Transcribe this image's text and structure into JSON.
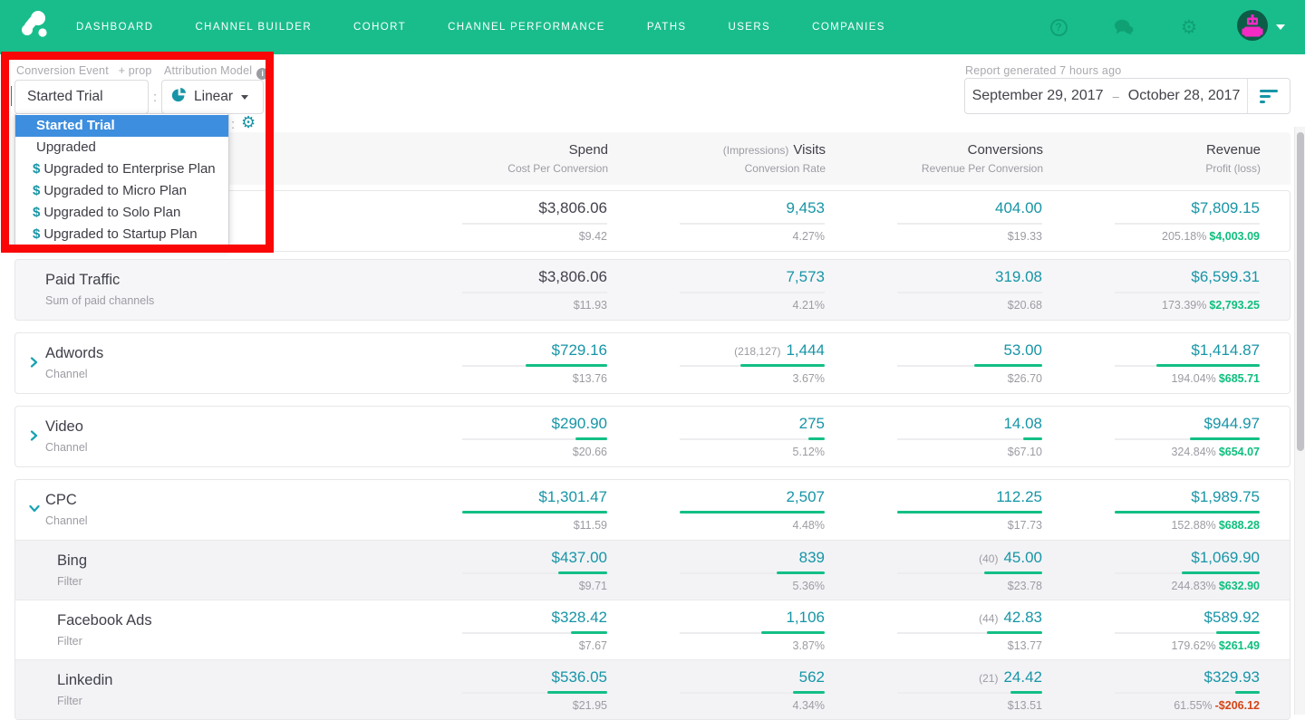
{
  "palette": {
    "nav_green": "#19bd8c",
    "teal_value": "#1795a6",
    "bar_green": "#13bf86",
    "profit_green": "#0ebf7e",
    "loss_red": "#d44517",
    "highlight_blue": "#3d8ede",
    "annotation_red": "#fa0606"
  },
  "nav": {
    "items": [
      {
        "label": "DASHBOARD"
      },
      {
        "label": "CHANNEL BUILDER"
      },
      {
        "label": "COHORT"
      },
      {
        "label": "CHANNEL PERFORMANCE"
      },
      {
        "label": "PATHS"
      },
      {
        "label": "USERS"
      },
      {
        "label": "COMPANIES"
      }
    ],
    "help_glyph": "?",
    "gear_glyph": "⚙"
  },
  "controls": {
    "conversion_event": {
      "label": "Conversion Event",
      "prop_link": "+ prop",
      "value": "Started Trial"
    },
    "separator": ":",
    "attribution_model": {
      "label": "Attribution Model",
      "value": "Linear"
    },
    "dropdown": {
      "items": [
        {
          "prefix": "",
          "label": "Started Trial"
        },
        {
          "prefix": "",
          "label": "Upgraded"
        },
        {
          "prefix": "$",
          "label": "Upgraded to Enterprise Plan"
        },
        {
          "prefix": "$",
          "label": "Upgraded to Micro Plan"
        },
        {
          "prefix": "$",
          "label": "Upgraded to Solo Plan"
        },
        {
          "prefix": "$",
          "label": "Upgraded to Startup Plan"
        }
      ]
    }
  },
  "report": {
    "generated": "Report generated 7 hours ago",
    "date_start": "September 29, 2017",
    "date_separator": "–",
    "date_end": "October 28, 2017"
  },
  "table": {
    "headers": {
      "spend": {
        "main": "Spend",
        "sub": "Cost Per Conversion"
      },
      "visits": {
        "pre": "(Impressions)",
        "main": "Visits",
        "sub": "Conversion Rate"
      },
      "conversions": {
        "main": "Conversions",
        "sub": "Revenue Per Conversion"
      },
      "revenue": {
        "main": "Revenue",
        "sub": "Profit (loss)"
      }
    },
    "rows": [
      {
        "name": "",
        "subtitle": "",
        "spend": "$3,806.06",
        "cpc": "$9.42",
        "impressions": "",
        "visits": "9,453",
        "rate": "4.27%",
        "conv_pre": "",
        "conversions": "404.00",
        "rpc": "$19.33",
        "revenue": "$7,809.15",
        "profit_pct": "205.18%",
        "profit": "$4,003.09",
        "bars": {
          "spend": 0,
          "visits": 0,
          "conversions": 0,
          "revenue": 0
        }
      },
      {
        "name": "Paid Traffic",
        "subtitle": "Sum of paid channels",
        "spend": "$3,806.06",
        "cpc": "$11.93",
        "impressions": "",
        "visits": "7,573",
        "rate": "4.21%",
        "conv_pre": "",
        "conversions": "319.08",
        "rpc": "$20.68",
        "revenue": "$6,599.31",
        "profit_pct": "173.39%",
        "profit": "$2,793.25",
        "bars": {
          "spend": 0,
          "visits": 0,
          "conversions": 0,
          "revenue": 0
        }
      },
      {
        "name": "Adwords",
        "subtitle": "Channel",
        "spend": "$729.16",
        "cpc": "$13.76",
        "impressions": "(218,127)",
        "visits": "1,444",
        "rate": "3.67%",
        "conv_pre": "",
        "conversions": "53.00",
        "rpc": "$26.70",
        "revenue": "$1,414.87",
        "profit_pct": "194.04%",
        "profit": "$685.71",
        "bars": {
          "spend": 0.56,
          "visits": 0.58,
          "conversions": 0.47,
          "revenue": 0.71
        }
      },
      {
        "name": "Video",
        "subtitle": "Channel",
        "spend": "$290.90",
        "cpc": "$20.66",
        "impressions": "",
        "visits": "275",
        "rate": "5.12%",
        "conv_pre": "",
        "conversions": "14.08",
        "rpc": "$67.10",
        "revenue": "$944.97",
        "profit_pct": "324.84%",
        "profit": "$654.07",
        "bars": {
          "spend": 0.22,
          "visits": 0.11,
          "conversions": 0.13,
          "revenue": 0.48
        }
      },
      {
        "name": "CPC",
        "subtitle": "Channel",
        "spend": "$1,301.47",
        "cpc": "$11.59",
        "impressions": "",
        "visits": "2,507",
        "rate": "4.48%",
        "conv_pre": "",
        "conversions": "112.25",
        "rpc": "$17.73",
        "revenue": "$1,989.75",
        "profit_pct": "152.88%",
        "profit": "$688.28",
        "bars": {
          "spend": 1,
          "visits": 1,
          "conversions": 1,
          "revenue": 1
        }
      },
      {
        "name": "Bing",
        "subtitle": "Filter",
        "spend": "$437.00",
        "cpc": "$9.71",
        "impressions": "",
        "visits": "839",
        "rate": "5.36%",
        "conv_pre": "(40)",
        "conversions": "45.00",
        "rpc": "$23.78",
        "revenue": "$1,069.90",
        "profit_pct": "244.83%",
        "profit": "$632.90",
        "bars": {
          "spend": 0.34,
          "visits": 0.33,
          "conversions": 0.4,
          "revenue": 0.54
        }
      },
      {
        "name": "Facebook Ads",
        "subtitle": "Filter",
        "spend": "$328.42",
        "cpc": "$7.67",
        "impressions": "",
        "visits": "1,106",
        "rate": "3.87%",
        "conv_pre": "(44)",
        "conversions": "42.83",
        "rpc": "$13.77",
        "revenue": "$589.92",
        "profit_pct": "179.62%",
        "profit": "$261.49",
        "bars": {
          "spend": 0.25,
          "visits": 0.44,
          "conversions": 0.38,
          "revenue": 0.3
        }
      },
      {
        "name": "Linkedin",
        "subtitle": "Filter",
        "spend": "$536.05",
        "cpc": "$21.95",
        "impressions": "",
        "visits": "562",
        "rate": "4.34%",
        "conv_pre": "(21)",
        "conversions": "24.42",
        "rpc": "$13.51",
        "revenue": "$329.93",
        "profit_pct": "61.55%",
        "profit": "-$206.12",
        "bars": {
          "spend": 0.41,
          "visits": 0.22,
          "conversions": 0.22,
          "revenue": 0.17
        }
      }
    ]
  }
}
